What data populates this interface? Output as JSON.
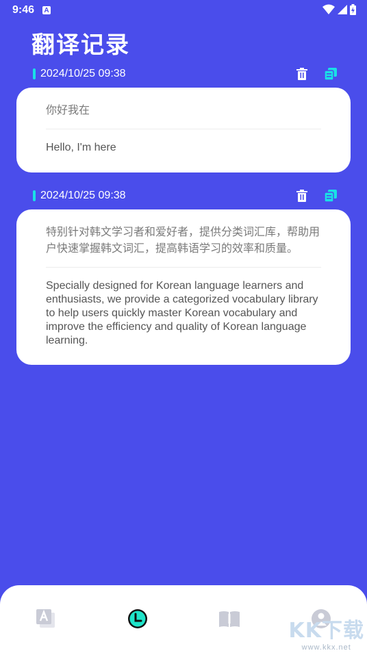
{
  "status_bar": {
    "time": "9:46",
    "notification_icon": "A"
  },
  "page": {
    "title": "翻译记录"
  },
  "records": [
    {
      "timestamp": "2024/10/25 09:38",
      "source_text": "你好我在",
      "translated_text": "Hello, I'm here"
    },
    {
      "timestamp": "2024/10/25 09:38",
      "source_text": "特别针对韩文学习者和爱好者，提供分类词汇库，帮助用户快速掌握韩文词汇，提高韩语学习的效率和质量。",
      "translated_text": "Specially designed for Korean language learners and enthusiasts, we provide a categorized vocabulary library to help users quickly master Korean vocabulary and improve the efficiency and quality of Korean language learning."
    }
  ],
  "bottom_nav": {
    "items": [
      {
        "icon": "translate-icon",
        "active": false
      },
      {
        "icon": "history-clock-icon",
        "active": true
      },
      {
        "icon": "book-icon",
        "active": false
      },
      {
        "icon": "profile-icon",
        "active": false
      }
    ]
  },
  "watermark": {
    "logo": "KK下载",
    "url": "www.kkx.net"
  },
  "colors": {
    "background": "#4a4deb",
    "accent": "#19e0e6",
    "card": "#ffffff",
    "inactive_nav": "#c9cbd6"
  }
}
